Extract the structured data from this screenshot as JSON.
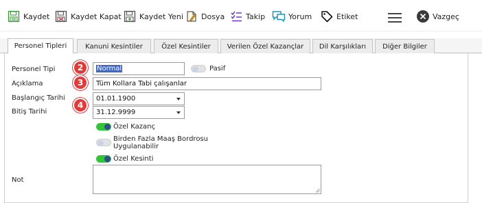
{
  "toolbar": {
    "save": "Kaydet",
    "save_close": "Kaydet Kapat",
    "save_new": "Kaydet Yeni",
    "file": "Dosya",
    "follow": "Takip",
    "comment": "Yorum",
    "tag": "Etiket",
    "cancel": "Vazgeç"
  },
  "tabs": [
    {
      "label": "Personel Tipleri",
      "active": true
    },
    {
      "label": "Kanuni Kesintiler"
    },
    {
      "label": "Özel Kesintiler"
    },
    {
      "label": "Verilen Özel Kazançlar"
    },
    {
      "label": "Dil Karşılıkları"
    },
    {
      "label": "Diğer Bilgiler"
    }
  ],
  "form": {
    "personel_tipi_label": "Personel Tipi",
    "personel_tipi_value": "Normal",
    "pasif_label": "Pasif",
    "aciklama_label": "Açıklama",
    "aciklama_value": "Tüm Kollara Tabi çalışanlar",
    "baslangic_label": "Başlangıç Tarihi",
    "baslangic_value": "01.01.1900",
    "bitis_label": "Bitiş Tarihi",
    "bitis_value": "31.12.9999",
    "ozel_kazanc_label": "Özel Kazanç",
    "birden_fazla_label_line1": "Birden Fazla Maaş Bordrosu",
    "birden_fazla_label_line2": "Uygulanabilir",
    "ozel_kesinti_label": "Özel Kesinti",
    "not_label": "Not",
    "pasif_on": false,
    "ozel_kazanc_on": true,
    "birden_fazla_on": false,
    "ozel_kesinti_on": true
  },
  "badges": [
    "2",
    "3",
    "4"
  ],
  "colors": {
    "accent_green": "#34c43a",
    "badge_red": "#e03a3a",
    "selection_blue": "#3f67c8",
    "icon_green": "#3a9a3a",
    "icon_purple": "#7a3fc8",
    "icon_teal": "#1b8fb8"
  },
  "icons": [
    "save-icon",
    "save-close-icon",
    "save-new-icon",
    "file-icon",
    "follow-icon",
    "comment-icon",
    "tag-icon",
    "menu-icon",
    "cancel-icon"
  ]
}
